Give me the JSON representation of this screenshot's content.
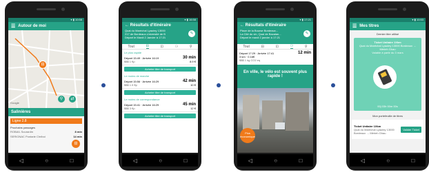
{
  "phones": {
    "p1": {
      "title": "Autour de moi",
      "stop_name": "Salinières",
      "line": "Ligne 2.8",
      "next_label": "Prochains passages",
      "departures": [
        {
          "dest": "ROBAIL Sourardin",
          "time": "8 min"
        },
        {
          "dest": "SERIGNAC Pontarie Chriboi",
          "time": "14 min"
        }
      ]
    },
    "p2": {
      "title": "Résultats d'itinéraire",
      "from": "Quai du Maréchal Lyautey 13000",
      "to": "217 de Bordeaux-Université de B",
      "when": "Départ le Mardi 2 Janvier à 17:21",
      "tab_all": "Tout",
      "sections": [
        "Le plus rapide",
        "Le moins de marche",
        "Le moins de correspondance"
      ],
      "results": [
        {
          "times": "Départ 15:49 · Arrivée 16:19",
          "duration": "30 min",
          "price": "8.9 €",
          "meta": "$$$ 1 €p",
          "button": "Acheter titre de transport"
        },
        {
          "times": "Départ 15:56 · Arrivée 16:29",
          "duration": "42 min",
          "price": "10 €",
          "meta": "$$$ 1.5 €p",
          "button": "Acheter titre de transport"
        },
        {
          "times": "Départ 15:41 · Arrivée 16:29",
          "duration": "45 min",
          "price": "12 €",
          "meta": "$$$ 3 €p",
          "button": "Acheter titre de transport"
        }
      ]
    },
    "p3": {
      "title": "Résultats d'itinéraire",
      "from": "Place de la Bourse Bordeaux...",
      "to": "La Cité du vin, Quai de Bacalan...",
      "when": "Départ le mardi 2 janvier à 17:21",
      "tab_all": "Tout",
      "times": "Départ 17:29 · Arrivée 17:41",
      "duration": "12 min",
      "distance": "3 km",
      "price": "0.16€",
      "meta": "$$$ 1 kg CO2 eq",
      "promo": "En ville, le vélo est souvent plus rapide !",
      "badge": "Plus économique"
    },
    "p4": {
      "title": "Mes titres",
      "section1": "Dernier titre utilisé",
      "ticket_title": "Ticket Unitaire 1Xkm",
      "ticket_sub": "Quai du Maréchal Lyautey 13000 Bordeaux → Mérieh Ghau",
      "ticket_date": "Valable à partir du 3 mars",
      "timer": "00j 03h 00m 00s",
      "section2": "Mon portefeuille de titres",
      "wallet_title": "Ticket Unitaire 1Xkm",
      "wallet_sub": "Quai du Maréchal Lyautey 13000 Bordeaux → Mérieh Ghau",
      "wallet_btn": "Valider Ticket"
    }
  },
  "colors": {
    "teal": "#26a387",
    "orange": "#f07a1a",
    "navy_dot": "#2a4f9a"
  }
}
